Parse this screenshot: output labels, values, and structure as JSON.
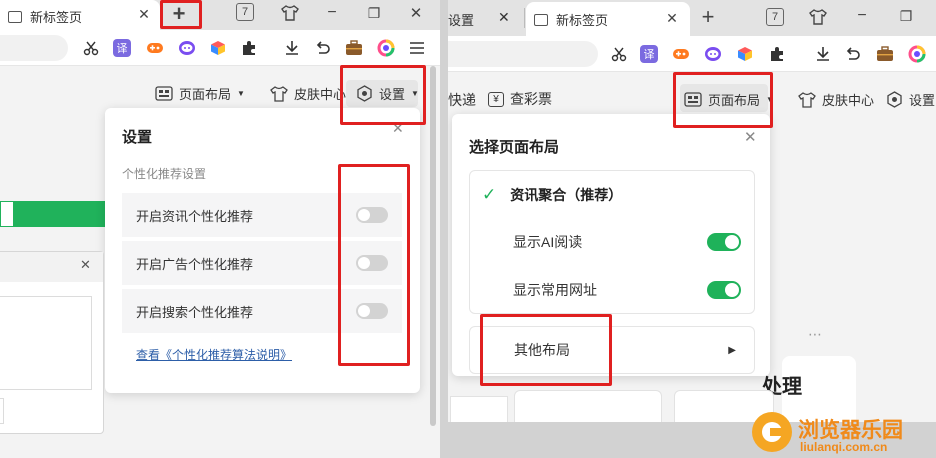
{
  "left": {
    "tab": {
      "title": "新标签页",
      "close": "✕"
    },
    "new_tab": "+",
    "tabbar_icons": {
      "calendar_day": "7",
      "shirt": "skin",
      "min": "−",
      "restore": "❐",
      "close": "✕"
    },
    "toolbar_icons": [
      "cut-icon",
      "translate-icon",
      "game-icon",
      "chat-icon",
      "cube-icon",
      "puzzle-icon",
      "download-icon",
      "undo-icon",
      "briefcase-icon",
      "colorful-icon",
      "menu-icon"
    ],
    "translate_label": "译",
    "nav": {
      "layout": "页面布局",
      "skin": "皮肤中心",
      "settings": "设置"
    },
    "settings_panel": {
      "title": "设置",
      "section": "个性化推荐设置",
      "rows": [
        {
          "label": "开启资讯个性化推荐",
          "on": false
        },
        {
          "label": "开启广告个性化推荐",
          "on": false
        },
        {
          "label": "开启搜索个性化推荐",
          "on": false
        }
      ],
      "link": "查看《个性化推荐算法说明》"
    }
  },
  "right": {
    "tab_partial": "设置",
    "tab": {
      "title": "新标签页",
      "close": "✕"
    },
    "new_tab": "+",
    "tabbar_icons": {
      "calendar_day": "7"
    },
    "translate_label": "译",
    "nav": {
      "kuaidi": "快递",
      "caipiao": "查彩票",
      "layout": "页面布局",
      "skin": "皮肤中心",
      "settings": "设置"
    },
    "layout_panel": {
      "title": "选择页面布局",
      "option_checked": "资讯聚合（推荐）",
      "sub_options": [
        {
          "label": "显示AI阅读",
          "on": true
        },
        {
          "label": "显示常用网址",
          "on": true
        }
      ],
      "other": "其他布局"
    },
    "bg_text": "处理",
    "more": "⋯"
  },
  "watermark": {
    "name": "浏览器乐园",
    "url": "liulanqi.com.cn"
  },
  "colors": {
    "accent_red": "#e02020",
    "green": "#20b25b",
    "link": "#2d5ea8"
  }
}
